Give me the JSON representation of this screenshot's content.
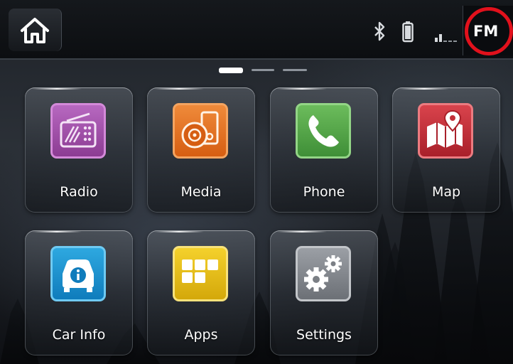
{
  "statusbar": {
    "home_icon": "home-icon",
    "bluetooth_icon": "bluetooth-icon",
    "battery_icon": "battery-icon",
    "signal_icon": "signal-bars-icon",
    "source_label": "FM",
    "source_highlight_color": "#e1111c"
  },
  "pager": {
    "page_count": 3,
    "active_page": 1
  },
  "apps": [
    {
      "label": "Radio",
      "icon": "radio-icon",
      "color": "#a24fa9"
    },
    {
      "label": "Media",
      "icon": "media-icon",
      "color": "#e2711f"
    },
    {
      "label": "Phone",
      "icon": "phone-icon",
      "color": "#55a848"
    },
    {
      "label": "Map",
      "icon": "map-icon",
      "color": "#c23039"
    },
    {
      "label": "Car Info",
      "icon": "car-info-icon",
      "color": "#1d93d0"
    },
    {
      "label": "Apps",
      "icon": "apps-grid-icon",
      "color": "#e4bd16"
    },
    {
      "label": "Settings",
      "icon": "gears-icon",
      "color": "#85898f"
    }
  ]
}
